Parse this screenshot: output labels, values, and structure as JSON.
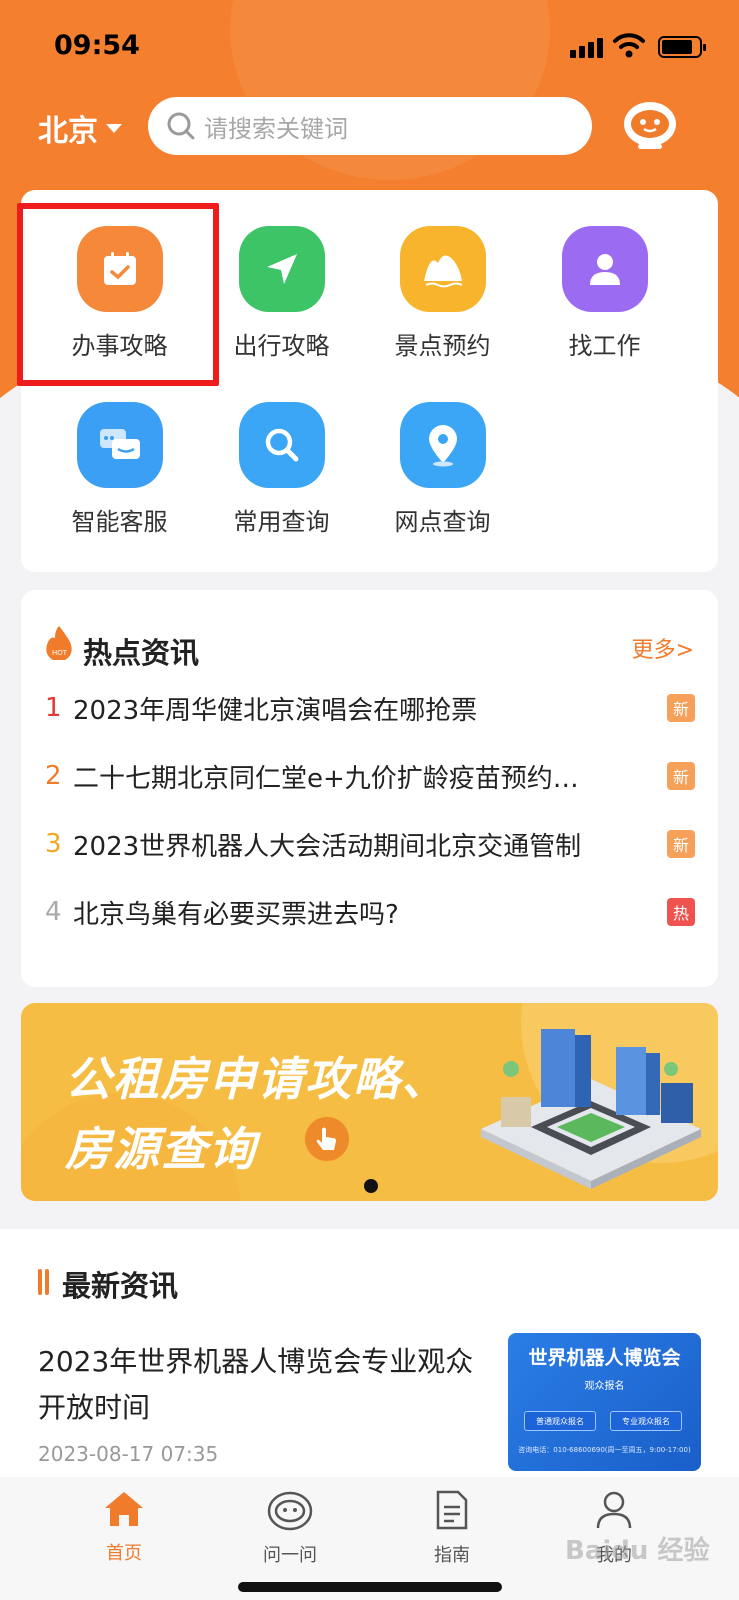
{
  "status_bar": {
    "time": "09:54"
  },
  "header": {
    "city": "北京",
    "search_placeholder": "请搜索关键词"
  },
  "services": [
    {
      "label": "办事攻略",
      "icon": "calendar-check-icon",
      "color": "#f6883a"
    },
    {
      "label": "出行攻略",
      "icon": "navigation-arrow-icon",
      "color": "#3cc467"
    },
    {
      "label": "景点预约",
      "icon": "mountain-icon",
      "color": "#f8b42c"
    },
    {
      "label": "找工作",
      "icon": "person-icon",
      "color": "#9b6cf1"
    },
    {
      "label": "智能客服",
      "icon": "chat-bubbles-icon",
      "color": "#3a9ff5"
    },
    {
      "label": "常用查询",
      "icon": "magnifier-icon",
      "color": "#3aa6f5"
    },
    {
      "label": "网点查询",
      "icon": "map-pin-icon",
      "color": "#3aa6f5"
    }
  ],
  "hot_news": {
    "title": "热点资讯",
    "more": "更多>",
    "items": [
      {
        "rank": "1",
        "text": "2023年周华健北京演唱会在哪抢票",
        "tag": "新",
        "rank_color": "#e53935",
        "tag_color": "#f5a15a"
      },
      {
        "rank": "2",
        "text": "二十七期北京同仁堂e+九价扩龄疫苗预约…",
        "tag": "新",
        "rank_color": "#f07b2b",
        "tag_color": "#f5a15a"
      },
      {
        "rank": "3",
        "text": "2023世界机器人大会活动期间北京交通管制",
        "tag": "新",
        "rank_color": "#f5a623",
        "tag_color": "#f5a15a"
      },
      {
        "rank": "4",
        "text": "北京鸟巢有必要买票进去吗?",
        "tag": "热",
        "rank_color": "#aaaaaa",
        "tag_color": "#ef5350"
      }
    ]
  },
  "banner": {
    "line1": "公租房申请攻略、",
    "line2": "房源查询"
  },
  "latest": {
    "title": "最新资讯",
    "article_title": "2023年世界机器人博览会专业观众开放时间",
    "date": "2023-08-17 07:35",
    "thumb": {
      "title": "世界机器人博览会",
      "subtitle": "观众报名",
      "btn1": "普通观众报名",
      "btn2": "专业观众报名",
      "phone": "咨询电话：010-68600690(周一至周五，9:00-17:00)"
    }
  },
  "tabs": [
    {
      "label": "首页",
      "icon": "home-icon",
      "active": true
    },
    {
      "label": "问一问",
      "icon": "robot-icon",
      "active": false
    },
    {
      "label": "指南",
      "icon": "document-icon",
      "active": false
    },
    {
      "label": "我的",
      "icon": "user-icon",
      "active": false
    }
  ],
  "watermark": "Baidu 经验"
}
